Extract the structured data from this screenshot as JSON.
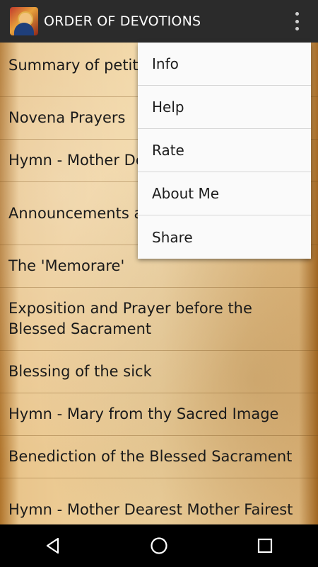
{
  "appbar": {
    "title": "ORDER OF DEVOTIONS",
    "icon": "app-logo-icon",
    "overflow_icon": "overflow-menu-icon"
  },
  "list": {
    "items": [
      {
        "label": "Summary of petitions and thanksgivings"
      },
      {
        "label": "Novena Prayers"
      },
      {
        "label": "Hymn - Mother Dearest"
      },
      {
        "label": "Announcements and Silent Prayer"
      },
      {
        "label": "The 'Memorare'"
      },
      {
        "label": "Exposition and Prayer before the Blessed Sacrament"
      },
      {
        "label": "Blessing of the sick"
      },
      {
        "label": "Hymn - Mary from thy Sacred Image"
      },
      {
        "label": "Benediction of the Blessed Sacrament"
      },
      {
        "label": "Hymn - Mother Dearest Mother Fairest"
      }
    ]
  },
  "menu": {
    "items": [
      {
        "label": "Info"
      },
      {
        "label": "Help"
      },
      {
        "label": "Rate"
      },
      {
        "label": "About Me"
      },
      {
        "label": "Share"
      }
    ]
  },
  "navbar": {
    "back_icon": "back-icon",
    "home_icon": "home-icon",
    "recents_icon": "recents-icon"
  }
}
